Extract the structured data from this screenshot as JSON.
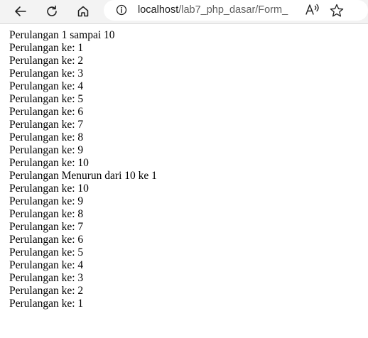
{
  "browser": {
    "url_host": "localhost",
    "url_path": "/lab7_php_dasar/Form_i...",
    "icons": {
      "back": "back-arrow-icon",
      "reload": "reload-icon",
      "home": "home-icon",
      "info": "info-icon",
      "read_aloud": "read-aloud-icon",
      "favorite": "favorite-star-icon"
    }
  },
  "page": {
    "lines": [
      "Perulangan 1 sampai 10",
      "Perulangan ke: 1",
      "Perulangan ke: 2",
      "Perulangan ke: 3",
      "Perulangan ke: 4",
      "Perulangan ke: 5",
      "Perulangan ke: 6",
      "Perulangan ke: 7",
      "Perulangan ke: 8",
      "Perulangan ke: 9",
      "Perulangan ke: 10",
      "Perulangan Menurun dari 10 ke 1",
      "Perulangan ke: 10",
      "Perulangan ke: 9",
      "Perulangan ke: 8",
      "Perulangan ke: 7",
      "Perulangan ke: 6",
      "Perulangan ke: 5",
      "Perulangan ke: 4",
      "Perulangan ke: 3",
      "Perulangan ke: 2",
      "Perulangan ke: 1"
    ]
  }
}
